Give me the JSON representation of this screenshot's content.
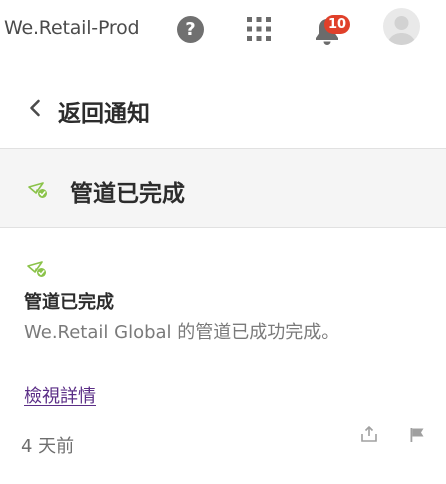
{
  "header": {
    "app_name": "We.Retail-Prod",
    "notification_count": "10",
    "icons": [
      "help-icon",
      "apps-grid-icon",
      "bell-icon",
      "avatar"
    ]
  },
  "back": {
    "label": "返回通知",
    "icon": "chevron-left-icon"
  },
  "section": {
    "title": "管道已完成",
    "icon": "pipeline-success-icon",
    "icon_color": "#8bc34a"
  },
  "notification": {
    "title": "管道已完成",
    "description": "We.Retail Global 的管道已成功完成。",
    "details_link": "檢視詳情",
    "time": "4 天前",
    "actions": [
      "share-icon",
      "flag-icon"
    ],
    "link_color": "#5a2d86"
  }
}
